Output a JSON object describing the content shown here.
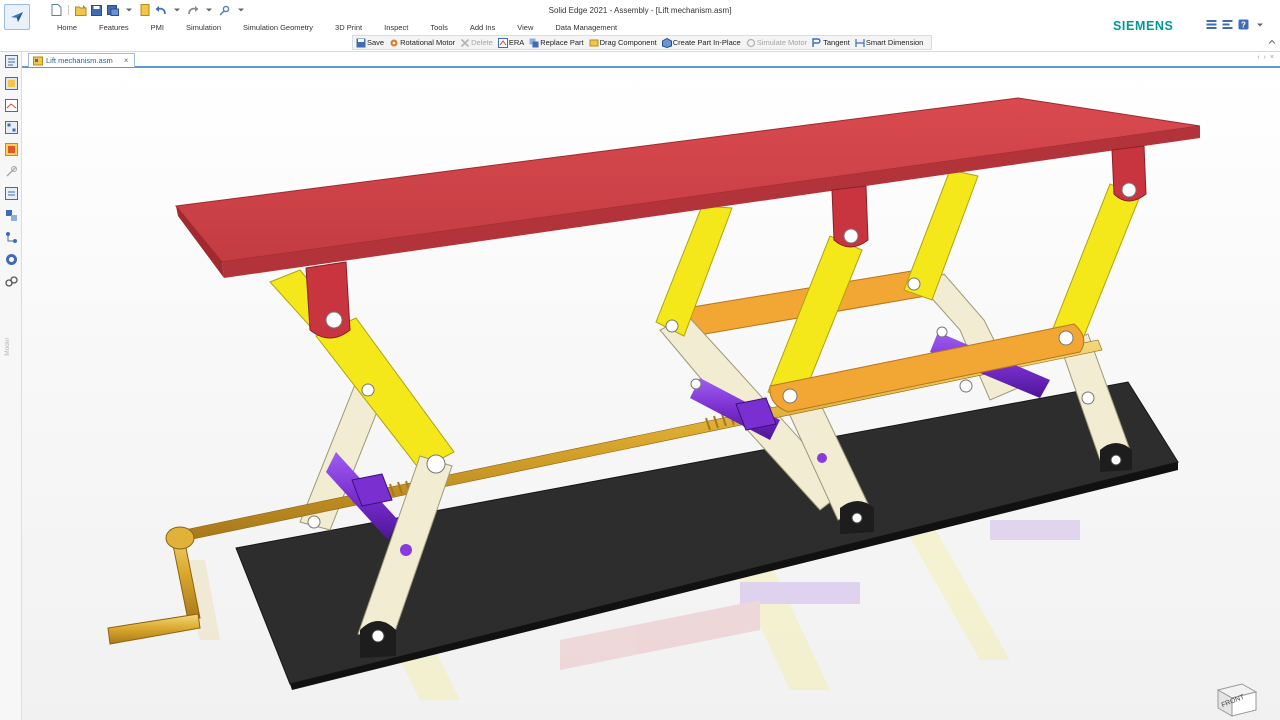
{
  "window": {
    "title": "Solid Edge 2021 - Assembly - [Lift mechanism.asm]",
    "brand": "SIEMENS"
  },
  "quick_access": [
    "new-icon",
    "open-icon",
    "save-icon",
    "save-as-icon",
    "document-icon",
    "undo-icon",
    "redo-icon",
    "customize-icon"
  ],
  "menu": {
    "tabs": [
      "Home",
      "Features",
      "PMI",
      "Simulation",
      "Simulation Geometry",
      "3D Print",
      "Inspect",
      "Tools",
      "Add Ins",
      "View",
      "Data Management"
    ]
  },
  "commands": [
    {
      "id": "save",
      "label": "Save",
      "icon": "save-icon",
      "enabled": true
    },
    {
      "id": "rotational-motor",
      "label": "Rotational Motor",
      "icon": "motor-icon",
      "enabled": true
    },
    {
      "id": "delete",
      "label": "Delete",
      "icon": "delete-icon",
      "enabled": false
    },
    {
      "id": "era",
      "label": "ERA",
      "icon": "era-icon",
      "enabled": true
    },
    {
      "id": "replace-part",
      "label": "Replace Part",
      "icon": "replace-icon",
      "enabled": true
    },
    {
      "id": "drag-component",
      "label": "Drag Component",
      "icon": "drag-icon",
      "enabled": true
    },
    {
      "id": "create-part-in-place",
      "label": "Create Part In-Place",
      "icon": "create-part-icon",
      "enabled": true
    },
    {
      "id": "simulate-motor",
      "label": "Simulate Motor",
      "icon": "simulate-icon",
      "enabled": false
    },
    {
      "id": "tangent",
      "label": "Tangent",
      "icon": "tangent-icon",
      "enabled": true
    },
    {
      "id": "smart-dimension",
      "label": "Smart Dimension",
      "icon": "dimension-icon",
      "enabled": true
    }
  ],
  "left_rail": {
    "label": "Model"
  },
  "document": {
    "tab_label": "Lift mechanism.asm",
    "close_glyph": "×"
  },
  "view_cube": {
    "label": "FRONT"
  },
  "colors": {
    "table_top": "#d8464b",
    "bracket": "#c9353f",
    "yellow_link": "#f4e81a",
    "cream_link": "#f1ecd2",
    "orange_bar": "#f2a633",
    "purple_shaft": "#7a2fd0",
    "screw_gold": "#e0b23a",
    "base": "#2d2d2d",
    "brand": "#00999a"
  }
}
